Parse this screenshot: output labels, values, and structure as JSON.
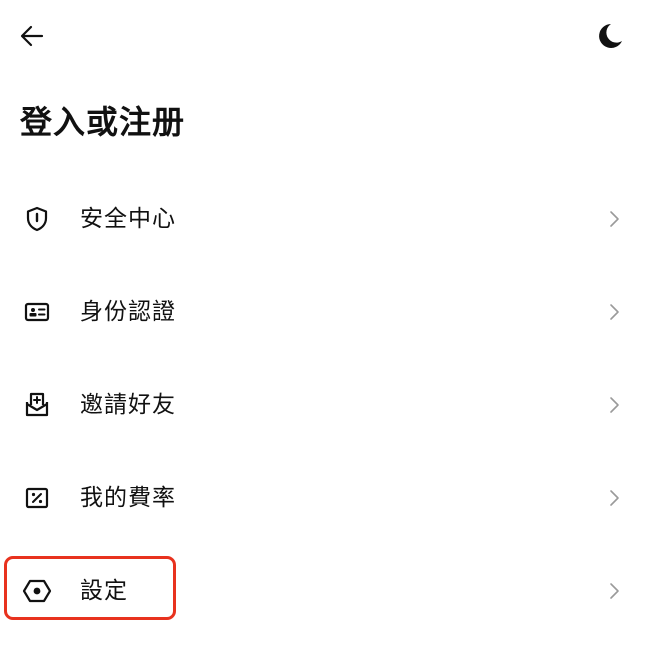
{
  "header": {
    "back_icon": "arrow-left-icon",
    "theme_icon": "moon-icon"
  },
  "page_title": "登入或注册",
  "menu": [
    {
      "label": "安全中心",
      "icon": "shield-icon"
    },
    {
      "label": "身份認證",
      "icon": "id-card-icon"
    },
    {
      "label": "邀請好友",
      "icon": "invite-mail-icon"
    },
    {
      "label": "我的費率",
      "icon": "fee-rate-icon"
    },
    {
      "label": "設定",
      "icon": "settings-hexagon-icon"
    }
  ],
  "highlight_color": "#e8321e",
  "text_color": "#111111",
  "chevron_color": "#9a9a9a"
}
